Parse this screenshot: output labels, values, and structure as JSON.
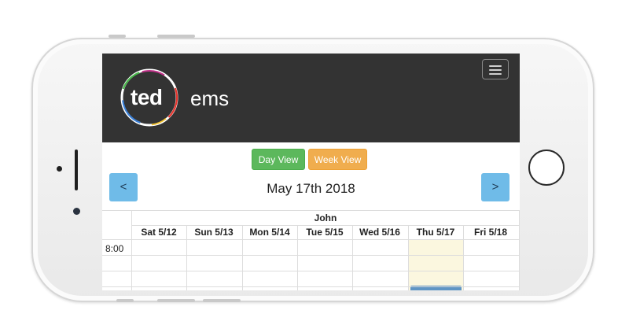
{
  "brand": {
    "logo_text": "ted",
    "suffix": "ems"
  },
  "toolbar": {
    "day_view_label": "Day View",
    "week_view_label": "Week View"
  },
  "navigation": {
    "prev_label": "<",
    "next_label": ">",
    "current_date": "May 17th 2018"
  },
  "calendar": {
    "resource": "John",
    "days": [
      "Sat 5/12",
      "Sun 5/13",
      "Mon 5/14",
      "Tue 5/15",
      "Wed 5/16",
      "Thu 5/17",
      "Fri 5/18"
    ],
    "highlighted_day": "Thu 5/17",
    "time_slots": [
      "8:00"
    ]
  },
  "colors": {
    "navbar": "#333333",
    "day_view_button": "#5cb85c",
    "week_view_button": "#f0ad4e",
    "arrow_button": "#6fbbe8",
    "today_highlight": "#fbf7df",
    "event": "#5f95c4"
  },
  "icons": {
    "menu": "hamburger-menu-icon",
    "logo": "ted-logo-icon"
  }
}
